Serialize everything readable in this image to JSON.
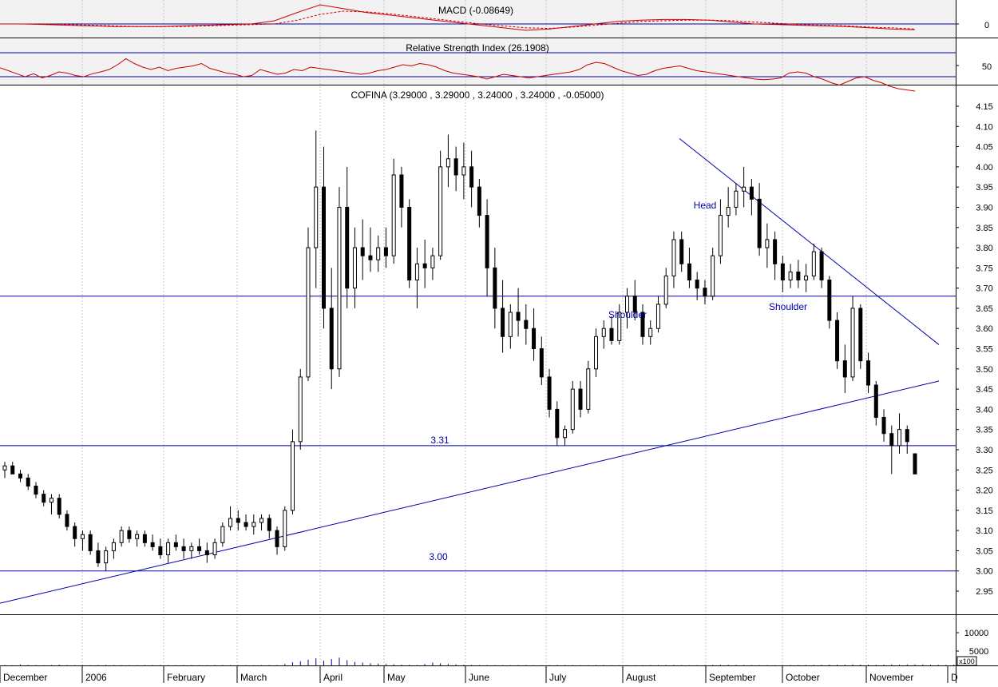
{
  "macd_panel": {
    "title": "MACD (-0.08649)",
    "ylabels": [
      "0"
    ],
    "series": {
      "macd": [
        0.0,
        0.0,
        -0.01,
        -0.02,
        -0.03,
        -0.04,
        -0.04,
        -0.04,
        -0.03,
        -0.02,
        -0.01,
        0.0,
        0.05,
        0.18,
        0.3,
        0.24,
        0.18,
        0.14,
        0.1,
        0.06,
        0.02,
        -0.02,
        -0.06,
        -0.1,
        -0.08,
        -0.04,
        0.0,
        0.04,
        0.06,
        0.07,
        0.07,
        0.06,
        0.03,
        0.0,
        -0.01,
        -0.02,
        -0.03,
        -0.04,
        -0.06,
        -0.08,
        -0.09
      ],
      "signal": [
        0.0,
        0.0,
        0.0,
        -0.01,
        -0.02,
        -0.03,
        -0.04,
        -0.04,
        -0.04,
        -0.03,
        -0.02,
        -0.01,
        0.0,
        0.06,
        0.15,
        0.2,
        0.19,
        0.16,
        0.12,
        0.08,
        0.04,
        0.0,
        -0.03,
        -0.06,
        -0.07,
        -0.05,
        -0.02,
        0.01,
        0.04,
        0.05,
        0.06,
        0.06,
        0.05,
        0.03,
        0.01,
        -0.01,
        -0.02,
        -0.03,
        -0.05,
        -0.06,
        -0.08
      ]
    }
  },
  "rsi_panel": {
    "title": "Relative Strength Index (26.1908)",
    "ylabels": [
      "50"
    ],
    "series": [
      65,
      60,
      55,
      50,
      55,
      48,
      52,
      58,
      56,
      52,
      50,
      55,
      58,
      62,
      70,
      80,
      72,
      66,
      62,
      66,
      60,
      64,
      66,
      68,
      72,
      64,
      60,
      56,
      54,
      50,
      52,
      62,
      58,
      54,
      56,
      62,
      60,
      66,
      64,
      62,
      60,
      58,
      56,
      54,
      56,
      60,
      62,
      66,
      70,
      68,
      72,
      70,
      66,
      60,
      56,
      54,
      52,
      50,
      46,
      50,
      54,
      52,
      50,
      48,
      50,
      52,
      54,
      56,
      58,
      62,
      70,
      74,
      72,
      66,
      60,
      56,
      52,
      54,
      60,
      64,
      66,
      68,
      64,
      60,
      58,
      56,
      54,
      52,
      50,
      48,
      46,
      45,
      46,
      48,
      56,
      58,
      56,
      50,
      46,
      40,
      36,
      42,
      48,
      50,
      44,
      40,
      34,
      30,
      28,
      26
    ]
  },
  "price_panel": {
    "title": "COFINA (3.29000 , 3.29000 , 3.24000 , 3.24000 , -0.05000)",
    "annotations": [
      "3.31",
      "3.00",
      "Head",
      "Shoulder",
      "Shoulder"
    ]
  },
  "volume_panel": {
    "ylabels": [
      "10000",
      "5000"
    ],
    "unit_label": "x100"
  },
  "x_labels": [
    "December",
    "2006",
    "February",
    "March",
    "April",
    "May",
    "June",
    "July",
    "August",
    "September",
    "October",
    "November",
    "D"
  ],
  "colors": {
    "line_blue": "#0000aa",
    "macd_red": "#cc0000",
    "panel_bg": "#f2f2f2",
    "grid": "#c8c8c8"
  },
  "chart_data": {
    "type": "candlestick",
    "title": "COFINA (3.29000 , 3.29000 , 3.24000 , 3.24000 , -0.05000)",
    "ylim": [
      2.9,
      4.15
    ],
    "y_ticks": [
      4.15,
      4.1,
      4.05,
      4.0,
      3.95,
      3.9,
      3.85,
      3.8,
      3.75,
      3.7,
      3.65,
      3.6,
      3.55,
      3.5,
      3.45,
      3.4,
      3.35,
      3.3,
      3.25,
      3.2,
      3.15,
      3.1,
      3.05,
      3.0,
      2.95
    ],
    "x_months": [
      "December",
      "2006",
      "February",
      "March",
      "April",
      "May",
      "June",
      "July",
      "August",
      "September",
      "October",
      "November",
      "D"
    ],
    "horizontal_levels": [
      3.68,
      3.31,
      3.0
    ],
    "trendlines": [
      {
        "name": "support",
        "from": {
          "t": 0,
          "price": 2.92
        },
        "to": {
          "t": 228,
          "price": 3.47
        }
      },
      {
        "name": "resistance",
        "from": {
          "t": 165,
          "price": 4.07
        },
        "to": {
          "t": 228,
          "price": 3.56
        }
      }
    ],
    "candles": [
      [
        3.25,
        3.27,
        3.23,
        3.26
      ],
      [
        3.26,
        3.27,
        3.24,
        3.24
      ],
      [
        3.24,
        3.25,
        3.22,
        3.23
      ],
      [
        3.23,
        3.24,
        3.2,
        3.21
      ],
      [
        3.21,
        3.22,
        3.18,
        3.19
      ],
      [
        3.19,
        3.2,
        3.16,
        3.17
      ],
      [
        3.17,
        3.19,
        3.14,
        3.18
      ],
      [
        3.18,
        3.19,
        3.13,
        3.14
      ],
      [
        3.14,
        3.15,
        3.1,
        3.11
      ],
      [
        3.11,
        3.12,
        3.06,
        3.08
      ],
      [
        3.08,
        3.1,
        3.05,
        3.09
      ],
      [
        3.09,
        3.1,
        3.04,
        3.05
      ],
      [
        3.05,
        3.07,
        3.01,
        3.02
      ],
      [
        3.02,
        3.06,
        3.0,
        3.05
      ],
      [
        3.05,
        3.08,
        3.03,
        3.07
      ],
      [
        3.07,
        3.11,
        3.06,
        3.1
      ],
      [
        3.1,
        3.11,
        3.07,
        3.08
      ],
      [
        3.08,
        3.1,
        3.06,
        3.09
      ],
      [
        3.09,
        3.1,
        3.06,
        3.07
      ],
      [
        3.07,
        3.09,
        3.05,
        3.06
      ],
      [
        3.06,
        3.08,
        3.03,
        3.04
      ],
      [
        3.04,
        3.08,
        3.02,
        3.07
      ],
      [
        3.07,
        3.09,
        3.05,
        3.06
      ],
      [
        3.06,
        3.08,
        3.03,
        3.05
      ],
      [
        3.05,
        3.07,
        3.03,
        3.06
      ],
      [
        3.06,
        3.08,
        3.04,
        3.05
      ],
      [
        3.05,
        3.07,
        3.02,
        3.04
      ],
      [
        3.04,
        3.08,
        3.03,
        3.07
      ],
      [
        3.07,
        3.12,
        3.06,
        3.11
      ],
      [
        3.11,
        3.16,
        3.1,
        3.13
      ],
      [
        3.13,
        3.15,
        3.1,
        3.12
      ],
      [
        3.12,
        3.14,
        3.1,
        3.11
      ],
      [
        3.11,
        3.14,
        3.09,
        3.12
      ],
      [
        3.12,
        3.14,
        3.1,
        3.13
      ],
      [
        3.13,
        3.14,
        3.08,
        3.1
      ],
      [
        3.1,
        3.11,
        3.04,
        3.06
      ],
      [
        3.06,
        3.16,
        3.05,
        3.15
      ],
      [
        3.15,
        3.35,
        3.14,
        3.32
      ],
      [
        3.32,
        3.5,
        3.3,
        3.48
      ],
      [
        3.48,
        3.85,
        3.47,
        3.8
      ],
      [
        3.8,
        4.09,
        3.7,
        3.95
      ],
      [
        3.95,
        4.05,
        3.6,
        3.65
      ],
      [
        3.65,
        3.75,
        3.45,
        3.5
      ],
      [
        3.5,
        3.95,
        3.48,
        3.9
      ],
      [
        3.9,
        4.0,
        3.65,
        3.7
      ],
      [
        3.7,
        3.85,
        3.65,
        3.8
      ],
      [
        3.8,
        3.87,
        3.72,
        3.78
      ],
      [
        3.78,
        3.85,
        3.74,
        3.77
      ],
      [
        3.77,
        3.83,
        3.74,
        3.8
      ],
      [
        3.8,
        3.85,
        3.75,
        3.78
      ],
      [
        3.78,
        4.02,
        3.76,
        3.98
      ],
      [
        3.98,
        4.0,
        3.85,
        3.9
      ],
      [
        3.9,
        3.92,
        3.7,
        3.72
      ],
      [
        3.72,
        3.8,
        3.65,
        3.76
      ],
      [
        3.76,
        3.82,
        3.7,
        3.75
      ],
      [
        3.75,
        3.8,
        3.72,
        3.78
      ],
      [
        3.78,
        4.04,
        3.77,
        4.0
      ],
      [
        4.0,
        4.08,
        3.95,
        4.02
      ],
      [
        4.02,
        4.05,
        3.94,
        3.98
      ],
      [
        3.98,
        4.06,
        3.92,
        4.0
      ],
      [
        4.0,
        4.04,
        3.9,
        3.95
      ],
      [
        3.95,
        3.97,
        3.85,
        3.88
      ],
      [
        3.88,
        3.92,
        3.68,
        3.75
      ],
      [
        3.75,
        3.8,
        3.6,
        3.65
      ],
      [
        3.65,
        3.72,
        3.54,
        3.58
      ],
      [
        3.58,
        3.66,
        3.55,
        3.64
      ],
      [
        3.64,
        3.7,
        3.58,
        3.62
      ],
      [
        3.62,
        3.66,
        3.56,
        3.6
      ],
      [
        3.6,
        3.65,
        3.52,
        3.55
      ],
      [
        3.55,
        3.58,
        3.46,
        3.48
      ],
      [
        3.48,
        3.5,
        3.38,
        3.4
      ],
      [
        3.4,
        3.42,
        3.31,
        3.33
      ],
      [
        3.33,
        3.36,
        3.31,
        3.35
      ],
      [
        3.35,
        3.47,
        3.34,
        3.45
      ],
      [
        3.45,
        3.47,
        3.38,
        3.4
      ],
      [
        3.4,
        3.52,
        3.39,
        3.5
      ],
      [
        3.5,
        3.6,
        3.48,
        3.58
      ],
      [
        3.58,
        3.62,
        3.55,
        3.6
      ],
      [
        3.6,
        3.63,
        3.56,
        3.57
      ],
      [
        3.57,
        3.66,
        3.56,
        3.64
      ],
      [
        3.64,
        3.7,
        3.6,
        3.68
      ],
      [
        3.68,
        3.72,
        3.62,
        3.64
      ],
      [
        3.64,
        3.66,
        3.56,
        3.58
      ],
      [
        3.58,
        3.62,
        3.56,
        3.6
      ],
      [
        3.6,
        3.68,
        3.59,
        3.66
      ],
      [
        3.66,
        3.75,
        3.65,
        3.73
      ],
      [
        3.73,
        3.84,
        3.7,
        3.82
      ],
      [
        3.82,
        3.84,
        3.74,
        3.76
      ],
      [
        3.76,
        3.8,
        3.7,
        3.72
      ],
      [
        3.72,
        3.74,
        3.67,
        3.7
      ],
      [
        3.7,
        3.72,
        3.66,
        3.68
      ],
      [
        3.68,
        3.8,
        3.67,
        3.78
      ],
      [
        3.78,
        3.92,
        3.76,
        3.88
      ],
      [
        3.88,
        3.95,
        3.85,
        3.9
      ],
      [
        3.9,
        3.96,
        3.88,
        3.94
      ],
      [
        3.94,
        4.0,
        3.9,
        3.95
      ],
      [
        3.95,
        3.97,
        3.88,
        3.92
      ],
      [
        3.92,
        3.96,
        3.78,
        3.8
      ],
      [
        3.8,
        3.86,
        3.75,
        3.82
      ],
      [
        3.82,
        3.84,
        3.72,
        3.76
      ],
      [
        3.76,
        3.78,
        3.69,
        3.72
      ],
      [
        3.72,
        3.76,
        3.7,
        3.74
      ],
      [
        3.74,
        3.77,
        3.7,
        3.72
      ],
      [
        3.72,
        3.76,
        3.69,
        3.73
      ],
      [
        3.73,
        3.81,
        3.72,
        3.79
      ],
      [
        3.79,
        3.8,
        3.7,
        3.72
      ],
      [
        3.72,
        3.73,
        3.6,
        3.62
      ],
      [
        3.62,
        3.64,
        3.5,
        3.52
      ],
      [
        3.52,
        3.56,
        3.44,
        3.48
      ],
      [
        3.48,
        3.68,
        3.47,
        3.65
      ],
      [
        3.65,
        3.66,
        3.5,
        3.52
      ],
      [
        3.52,
        3.54,
        3.44,
        3.46
      ],
      [
        3.46,
        3.47,
        3.36,
        3.38
      ],
      [
        3.38,
        3.4,
        3.32,
        3.34
      ],
      [
        3.34,
        3.36,
        3.24,
        3.31
      ],
      [
        3.31,
        3.39,
        3.29,
        3.35
      ],
      [
        3.35,
        3.36,
        3.29,
        3.32
      ],
      [
        3.29,
        3.29,
        3.24,
        3.24
      ]
    ],
    "volume": [
      100,
      50,
      300,
      150,
      80,
      60,
      120,
      200,
      90,
      70,
      110,
      60,
      90,
      150,
      100,
      80,
      70,
      60,
      90,
      80,
      100,
      70,
      60,
      80,
      90,
      70,
      60,
      80,
      120,
      90,
      80,
      70,
      60,
      80,
      90,
      100,
      400,
      900,
      1200,
      1600,
      2000,
      1300,
      1800,
      2200,
      1500,
      1000,
      800,
      600,
      500,
      400,
      300,
      200,
      150,
      100,
      400,
      800,
      600,
      400,
      300,
      200,
      150,
      100,
      90,
      80,
      70,
      60,
      80,
      100,
      60,
      50,
      80,
      120,
      90,
      70,
      60,
      50,
      80,
      100,
      70,
      60,
      50,
      40,
      60,
      80,
      100,
      120,
      140,
      80,
      60,
      70,
      90,
      160,
      200,
      180,
      150,
      120,
      90,
      80,
      70,
      60,
      80,
      90,
      100,
      120,
      140,
      160,
      200,
      180,
      220,
      260,
      240,
      200,
      180,
      220,
      280,
      250,
      300,
      280,
      260,
      200,
      180,
      160,
      240,
      220,
      180
    ],
    "volume_ylim": [
      0,
      14000
    ]
  }
}
